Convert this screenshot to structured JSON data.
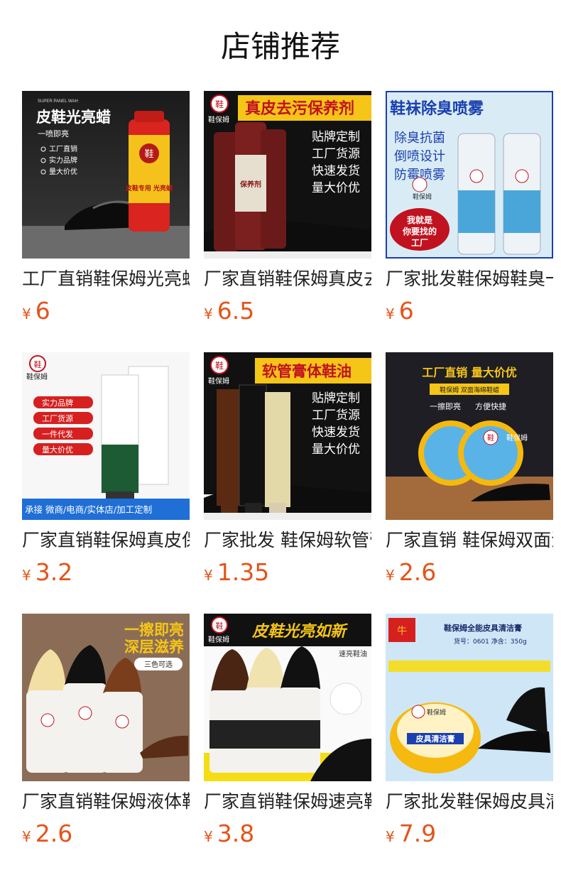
{
  "page": {
    "title": "店铺推荐",
    "accent_color": "#e4541a"
  },
  "currency": "¥",
  "products": [
    {
      "name": "工厂直销鞋保姆光亮蜡",
      "price": "6",
      "image": {
        "headline": "皮鞋光亮蜡",
        "sub": "一喷即亮",
        "tag": "SUPER PANEL WAH",
        "points": [
          "工厂直销",
          "实力品牌",
          "量大价优"
        ],
        "can_label": "皮鞋专用 光亮蜡"
      }
    },
    {
      "name": "厂家直销鞋保姆真皮去污保养剂",
      "price": "6.5",
      "image": {
        "headline": "真皮去污保养剂",
        "brand": "鞋保姆",
        "points": [
          "贴牌定制",
          "工厂货源",
          "快速发货",
          "量大价优"
        ]
      }
    },
    {
      "name": "厂家批发鞋保姆鞋臭一喷净",
      "price": "6",
      "image": {
        "headline": "鞋袜除臭喷雾",
        "brand": "鞋保姆",
        "points": [
          "除臭抗菌",
          "倒喷设计",
          "防霉喷雾"
        ],
        "badge": [
          "我就是",
          "你要找的",
          "工厂"
        ]
      }
    },
    {
      "name": "厂家直销鞋保姆真皮保养",
      "price": "3.2",
      "image": {
        "brand": "鞋保姆",
        "points": [
          "实力品牌",
          "工厂货源",
          "一件代发",
          "量大价优"
        ],
        "footer": "承接 微商/电商/实体店/加工定制"
      }
    },
    {
      "name": "厂家批发 鞋保姆软管膏体鞋油",
      "price": "1.35",
      "image": {
        "headline": "软管膏体鞋油",
        "brand": "鞋保姆",
        "points": [
          "贴牌定制",
          "工厂货源",
          "快速发货",
          "量大价优"
        ]
      }
    },
    {
      "name": "厂家直销 鞋保姆双面海绵鞋蜡",
      "price": "2.6",
      "image": {
        "headline": "工厂直销  量大价优",
        "sub": "鞋保姆 双面海绵鞋蜡",
        "points": [
          "一擦即亮",
          "方便快捷"
        ],
        "brand": "鞋保姆"
      }
    },
    {
      "name": "厂家直销鞋保姆液体鞋油",
      "price": "2.6",
      "image": {
        "headline": "一擦即亮",
        "sub": "深层滋养",
        "tag": "三色可选"
      }
    },
    {
      "name": "厂家直销鞋保姆速亮鞋油",
      "price": "3.8",
      "image": {
        "headline": "皮鞋光亮如新",
        "sub": "速亮鞋油",
        "brand": "鞋保姆"
      }
    },
    {
      "name": "厂家批发鞋保姆皮具清洁膏",
      "price": "7.9",
      "image": {
        "headline": "鞋保姆全能皮具清洁膏",
        "sub": "货号：0601  净含：350g",
        "brand": "鞋保姆",
        "label": "皮具清洁膏"
      }
    }
  ]
}
